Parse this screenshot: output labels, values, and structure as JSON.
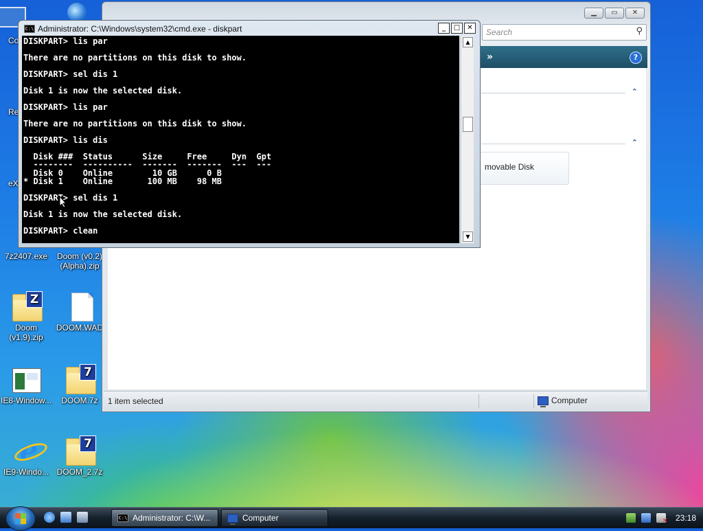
{
  "desktop": {
    "icons": [
      {
        "label": "Co"
      },
      {
        "label": "Re"
      },
      {
        "label": "eX"
      },
      {
        "label": "7z2407.exe"
      },
      {
        "label": "Doom (v0.2)\n(Alpha).zip"
      },
      {
        "label": "Doom\n(v1.9).zip"
      },
      {
        "label": "DOOM.WAD"
      },
      {
        "label": "IE8-Window..."
      },
      {
        "label": "DOOM.7z"
      },
      {
        "label": "IE9-Windo..."
      },
      {
        "label": "DOOM_2.7z"
      }
    ]
  },
  "explorer": {
    "search_placeholder": "Search",
    "toolbar_chevron": "»",
    "help_label": "?",
    "drive_tile_label": "movable Disk",
    "status_selected": "1 item selected",
    "status_location": "Computer"
  },
  "cmd": {
    "title": "Administrator: C:\\Windows\\system32\\cmd.exe - diskpart",
    "icon_text": "C:\\",
    "buttons": {
      "minimize": "_",
      "maximize": "□",
      "close": "✕"
    },
    "lines": [
      "DISKPART> lis par",
      "There are no partitions on this disk to show.",
      "DISKPART> sel dis 1",
      "Disk 1 is now the selected disk.",
      "DISKPART> lis par",
      "There are no partitions on this disk to show.",
      "DISKPART> lis dis",
      "  Disk ###  Status      Size     Free     Dyn  Gpt",
      "  --------  ----------  -------  -------  ---  ---",
      "  Disk 0    Online        10 GB      0 B",
      "* Disk 1    Online       100 MB    98 MB",
      "DISKPART> sel dis 1",
      "Disk 1 is now the selected disk.",
      "DISKPART> clean"
    ]
  },
  "taskbar": {
    "buttons": [
      {
        "label": "Administrator: C:\\W..."
      },
      {
        "label": "Computer"
      }
    ],
    "clock": "23:18"
  },
  "colors": {
    "console_bg": "#000000",
    "console_fg": "#ffffff",
    "explorer_toolbar": "#1e4e66"
  }
}
